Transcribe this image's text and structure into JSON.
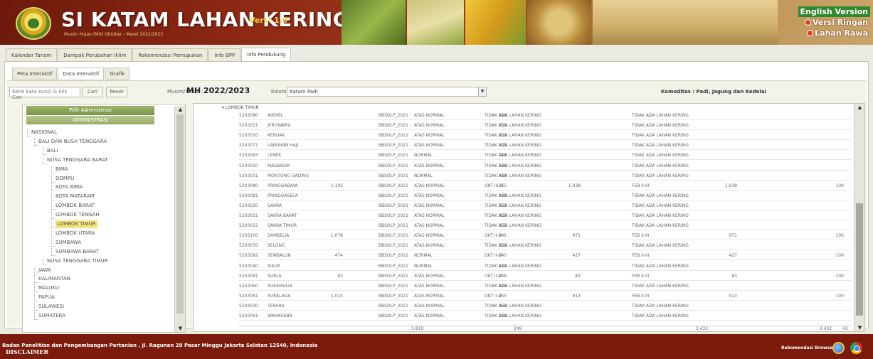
{
  "header": {
    "title": "SI KATAM LAHAN KERING",
    "version": "Versi 1.0",
    "subtitle": "Musim Hujan (MH) Oktober - Maret 2022/2023",
    "lang_links": {
      "english": "English Version",
      "ringan": "Versi Ringan",
      "rawa": "Lahan Rawa"
    }
  },
  "main_tabs": [
    "Kalender Tanam",
    "Dampak Perubahan Iklim",
    "Rekomendasi Pemupukan",
    "Info BPP",
    "Info Pendukung"
  ],
  "sub_tabs": [
    "Peta Interaktif",
    "Data Interaktif",
    "Grafik"
  ],
  "search": {
    "value": "Ketik kata kunci & klik Cari",
    "cari": "Cari",
    "reset": "Reset"
  },
  "musim": {
    "label": "Musim/Tahun :",
    "value": "MH 2022/2023"
  },
  "kolom": {
    "label": "Kolom :",
    "value": "Katam Padi"
  },
  "komoditas": "Komoditas : Padi, Jagung dan Kedelai",
  "tree": {
    "title": "Pilih Administrasi",
    "admin": "ADMINISTRASI",
    "nodes": [
      "NASIONAL",
      "BALI DAN NUSA TENGGARA",
      "BALI",
      "NUSA TENGGARA BARAT",
      "BIMA",
      "DOMPU",
      "KOTA BIMA",
      "KOTA MATARAM",
      "LOMBOK BARAT",
      "LOMBOK TENGAH",
      "LOMBOK TIMUR",
      "LOMBOK UTARA",
      "SUMBAWA",
      "SUMBAWA BARAT",
      "NUSA TENGGARA TIMUR",
      "JAWA",
      "KALIMANTAN",
      "MALUKU",
      "PAPUA",
      "SULAWESI",
      "SUMATERA"
    ],
    "selected_index": 10
  },
  "table": {
    "group": "LOMBOK TIMUR",
    "rows": [
      [
        "5203090",
        "AIKMEL",
        "",
        "BBSOLP_2021",
        "ATAS NORMAL",
        "246",
        "TIDAK ADA LAHAN KERING",
        "",
        "TIDAK ADA LAHAN KERING",
        "",
        ""
      ],
      [
        "5203011",
        "JEROWARU",
        "",
        "BBSOLP_2021",
        "ATAS NORMAL",
        "250",
        "TIDAK ADA LAHAN KERING",
        "",
        "TIDAK ADA LAHAN KERING",
        "",
        ""
      ],
      [
        "5203010",
        "KERUAK",
        "",
        "BBSOLP_2021",
        "ATAS NORMAL",
        "253",
        "TIDAK ADA LAHAN KERING",
        "",
        "TIDAK ADA LAHAN KERING",
        "",
        ""
      ],
      [
        "5203071",
        "LABUHAN HAJI",
        "",
        "BBSOLP_2021",
        "ATAS NORMAL",
        "255",
        "TIDAK ADA LAHAN KERING",
        "",
        "TIDAK ADA LAHAN KERING",
        "",
        ""
      ],
      [
        "5203093",
        "LENEK",
        "",
        "BBSOLP_2021",
        "NORMAL",
        "244",
        "TIDAK ADA LAHAN KERING",
        "",
        "TIDAK ADA LAHAN KERING",
        "",
        ""
      ],
      [
        "5203050",
        "MASBAGIK",
        "",
        "BBSOLP_2021",
        "ATAS NORMAL",
        "246",
        "TIDAK ADA LAHAN KERING",
        "",
        "TIDAK ADA LAHAN KERING",
        "",
        ""
      ],
      [
        "5203031",
        "MONTONG GADING",
        "",
        "BBSOLP_2021",
        "NORMAL",
        "244",
        "TIDAK ADA LAHAN KERING",
        "",
        "TIDAK ADA LAHAN KERING",
        "",
        ""
      ],
      [
        "5203080",
        "PRINGGABAYA",
        "1.102",
        "BBSOLP_2021",
        "ATAS NORMAL",
        "255",
        "OKT III-III",
        "1.038",
        "FEB II-III",
        "1.038",
        "100"
      ],
      [
        "5203081",
        "PRINGGASELA",
        "",
        "BBSOLP_2021",
        "ATAS NORMAL",
        "246",
        "TIDAK ADA LAHAN KERING",
        "",
        "TIDAK ADA LAHAN KERING",
        "",
        ""
      ],
      [
        "5203020",
        "SAKRA",
        "",
        "BBSOLP_2021",
        "ATAS NORMAL",
        "253",
        "TIDAK ADA LAHAN KERING",
        "",
        "TIDAK ADA LAHAN KERING",
        "",
        ""
      ],
      [
        "5203021",
        "SAKRA BARAT",
        "",
        "BBSOLP_2021",
        "ATAS NORMAL",
        "253",
        "TIDAK ADA LAHAN KERING",
        "",
        "TIDAK ADA LAHAN KERING",
        "",
        ""
      ],
      [
        "5203022",
        "SAKRA TIMUR",
        "",
        "BBSOLP_2021",
        "ATAS NORMAL",
        "255",
        "TIDAK ADA LAHAN KERING",
        "",
        "TIDAK ADA LAHAN KERING",
        "",
        ""
      ],
      [
        "5203100",
        "SAMBELIA",
        "1.078",
        "BBSOLP_2021",
        "ATAS NORMAL",
        "246",
        "OKT II-III",
        "971",
        "FEB II-III",
        "971",
        "100"
      ],
      [
        "5203070",
        "SELONG",
        "",
        "BBSOLP_2021",
        "ATAS NORMAL",
        "253",
        "TIDAK ADA LAHAN KERING",
        "",
        "TIDAK ADA LAHAN KERING",
        "",
        ""
      ],
      [
        "5203092",
        "SEMBALUN",
        "474",
        "BBSOLP_2021",
        "NORMAL",
        "240",
        "OKT II-III",
        "427",
        "FEB II-III",
        "427",
        "100"
      ],
      [
        "5203040",
        "SIKUR",
        "",
        "BBSOLP_2021",
        "NORMAL",
        "244",
        "TIDAK ADA LAHAN KERING",
        "",
        "TIDAK ADA LAHAN KERING",
        "",
        ""
      ],
      [
        "5203091",
        "SUELA",
        "92",
        "BBSOLP_2021",
        "ATAS NORMAL",
        "246",
        "OKT II-III",
        "83",
        "FEB II-III",
        "83",
        "100"
      ],
      [
        "5203060",
        "SUKAMULIA",
        "",
        "BBSOLP_2021",
        "ATAS NORMAL",
        "246",
        "TIDAK ADA LAHAN KERING",
        "",
        "TIDAK ADA LAHAN KERING",
        "",
        ""
      ],
      [
        "5203061",
        "SURALAGA",
        "1.014",
        "BBSOLP_2021",
        "ATAS NORMAL",
        "255",
        "OKT II-III",
        "913",
        "FEB II-III",
        "913",
        "100"
      ],
      [
        "5203030",
        "TERARA",
        "",
        "BBSOLP_2021",
        "ATAS NORMAL",
        "253",
        "TIDAK ADA LAHAN KERING",
        "",
        "TIDAK ADA LAHAN KERING",
        "",
        ""
      ],
      [
        "5203091",
        "WANASABA",
        "",
        "BBSOLP_2021",
        "ATAS NORMAL",
        "248",
        "TIDAK ADA LAHAN KERING",
        "",
        "TIDAK ADA LAHAN KERING",
        "",
        ""
      ]
    ],
    "footer": [
      "3.819",
      "249",
      "3.432",
      "3.432",
      "43"
    ]
  },
  "footer": {
    "address": "Badan Penelitian dan Pengembangan Pertanian , Jl. Ragunan 29 Pasar Minggu Jakarta Selatan 12540, Indonesia",
    "disclaimer": "DISCLAIMER",
    "rekomendasi": "Rekomendasi Browser"
  },
  "colors": {
    "header_bg": "#8f2a14",
    "footer_bg": "#7a1b0c",
    "english_link_bg": "#2f8a2f",
    "tree_title_bg": "#8ba35a",
    "selected_node": "#f4e27a"
  }
}
